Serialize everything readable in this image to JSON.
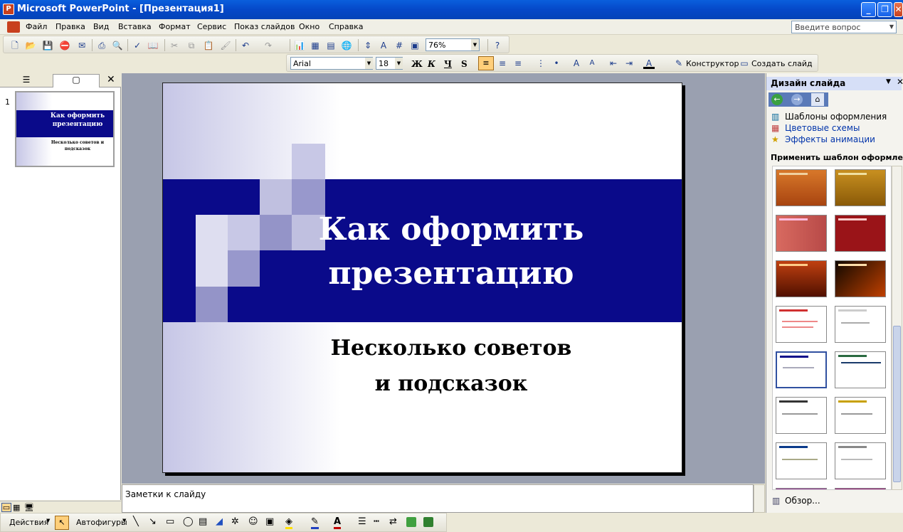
{
  "window": {
    "title": "Microsoft PowerPoint - [Презентация1]"
  },
  "menu": {
    "items": [
      "Файл",
      "Правка",
      "Вид",
      "Вставка",
      "Формат",
      "Сервис",
      "Показ слайдов",
      "Окно",
      "Справка"
    ]
  },
  "ask": {
    "placeholder": "Введите вопрос"
  },
  "standard_toolbar": {
    "zoom": "76%"
  },
  "format_toolbar": {
    "font": "Arial",
    "size": "18",
    "bold": "Ж",
    "italic": "К",
    "underline": "Ч",
    "shadow": "S",
    "designer": "Конструктор",
    "new_slide": "Создать слайд"
  },
  "slides_pane": {
    "slide_number": "1",
    "thumb_title": "Как оформить презентацию",
    "thumb_sub": "Несколько советов и подсказок"
  },
  "slide": {
    "title_line1": "Как оформить",
    "title_line2": "презентацию",
    "subtitle_line1": "Несколько советов",
    "subtitle_line2": "и подсказок"
  },
  "notes": {
    "placeholder": "Заметки к слайду"
  },
  "task_pane": {
    "title": "Дизайн слайда",
    "links": [
      "Шаблоны оформления",
      "Цветовые схемы",
      "Эффекты анимации"
    ],
    "apply_label": "Применить шаблон оформления:",
    "browse": "Обзор..."
  },
  "drawing_toolbar": {
    "actions": "Действия",
    "autoshapes": "Автофигуры"
  },
  "colors": {
    "band": "#0a0a8a",
    "accent": "#0548c8"
  }
}
